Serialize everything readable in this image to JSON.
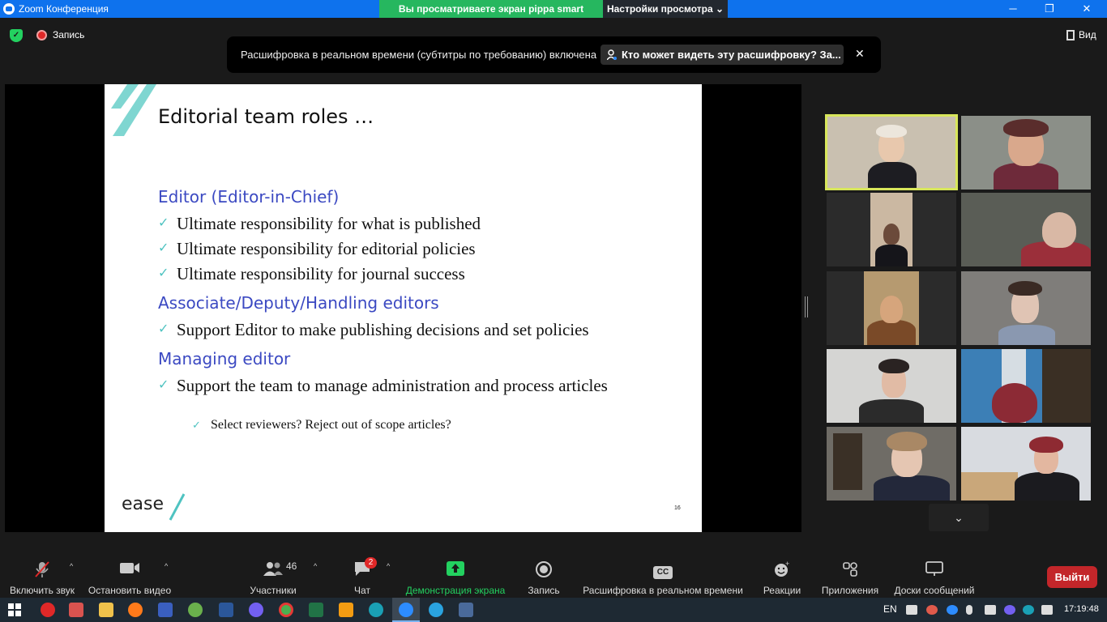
{
  "titlebar": {
    "app_title": "Zoom Конференция",
    "share_notice": "Вы просматриваете экран pippa smart",
    "view_options": "Настройки просмотра",
    "min": "─",
    "max": "❐",
    "close": "✕"
  },
  "topbar": {
    "recording": "Запись",
    "view": "Вид"
  },
  "captions": {
    "message": "Расшифровка в реальном времени (субтитры по требованию) включена",
    "who_can_see": "Кто может видеть эту расшифровку? За...",
    "close": "✕"
  },
  "slide": {
    "title": "Editorial team roles …",
    "sections": [
      {
        "heading": "Editor (Editor-in-Chief)"
      },
      {
        "heading": "Associate/Deputy/Handling editors"
      },
      {
        "heading": "Managing editor"
      }
    ],
    "bullets": [
      "Ultimate responsibility for what is published",
      "Ultimate responsibility for editorial policies",
      "Ultimate responsibility for journal success",
      "Support Editor to make publishing decisions and set policies",
      "Support the team to manage administration and process articles"
    ],
    "sub_bullet": "Select reviewers? Reject out of scope articles?",
    "check": "✓",
    "logo": "ease",
    "page_number": "16"
  },
  "gallery": {
    "down_arrow": "⌄"
  },
  "toolbar": {
    "unmute": "Включить звук",
    "stop_video": "Остановить видео",
    "participants": "Участники",
    "participants_count": "46",
    "chat": "Чат",
    "chat_badge": "2",
    "share_screen": "Демонстрация экрана",
    "record": "Запись",
    "live_transcript": "Расшифровка в реальном времени",
    "reactions": "Реакции",
    "apps": "Приложения",
    "whiteboards": "Доски сообщений",
    "leave": "Выйти",
    "cc": "CC",
    "caret": "^"
  },
  "taskbar": {
    "language": "EN",
    "time": "17:19:48"
  }
}
